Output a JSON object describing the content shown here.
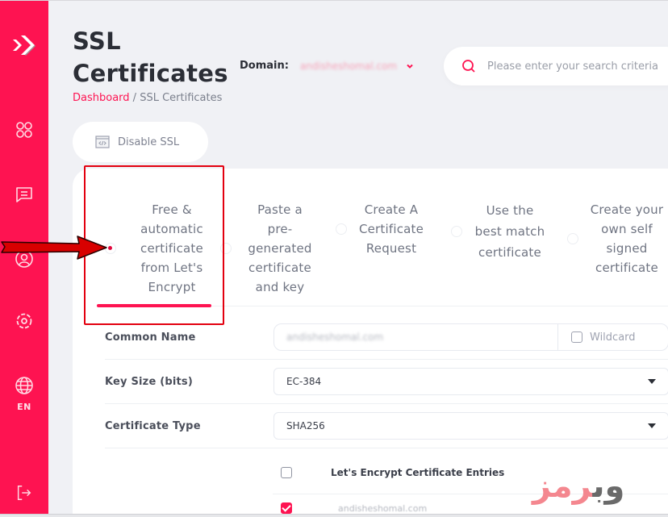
{
  "sidebar": {
    "items": [
      {
        "name": "logo",
        "icon": "double-chevron-logo-icon"
      },
      {
        "name": "dashboard",
        "icon": "apps-grid-icon"
      },
      {
        "name": "messages",
        "icon": "chat-icon"
      },
      {
        "name": "account",
        "icon": "user-circle-icon"
      },
      {
        "name": "settings",
        "icon": "gear-icon"
      },
      {
        "name": "language",
        "icon": "globe-icon",
        "label": "EN"
      },
      {
        "name": "logout",
        "icon": "logout-icon"
      }
    ]
  },
  "header": {
    "title_line1": "SSL",
    "title_line2": "Certificates",
    "breadcrumb": {
      "link": "Dashboard",
      "separator": " / ",
      "current": "SSL Certificates"
    },
    "domain_label": "Domain:",
    "domain_value": "andisheshomal.com",
    "search_placeholder": "Please enter your search criteria"
  },
  "actions": {
    "disable_ssl": "Disable SSL"
  },
  "certificate_options": [
    {
      "label": "Free & automatic certificate from Let's Encrypt",
      "lines": [
        "Free &",
        "automatic",
        "certificate",
        "from Let's",
        "Encrypt"
      ],
      "selected": true
    },
    {
      "label": "Paste a pre-generated certificate and key",
      "lines": [
        "Paste a",
        "pre-",
        "generated",
        "certificate",
        "and key"
      ],
      "selected": false
    },
    {
      "label": "Create A Certificate Request",
      "lines": [
        "Create A",
        "Certificate",
        "Request"
      ],
      "selected": false
    },
    {
      "label": "Use the best match certificate",
      "lines": [
        "Use the",
        "best match",
        "certificate"
      ],
      "selected": false
    },
    {
      "label": "Create your own self signed certificate",
      "lines": [
        "Create your",
        "own self",
        "signed",
        "certificate"
      ],
      "selected": false
    }
  ],
  "form": {
    "common_name": {
      "label": "Common Name",
      "value": "andisheshomal.com",
      "wildcard_label": "Wildcard",
      "wildcard_checked": false
    },
    "key_size": {
      "label": "Key Size (bits)",
      "value": "EC-384"
    },
    "certificate_type": {
      "label": "Certificate Type",
      "value": "SHA256"
    }
  },
  "entries": {
    "header": "Let's Encrypt Certificate Entries",
    "header_checked": false,
    "rows": [
      {
        "value": "andisheshomal.com",
        "checked": true
      }
    ]
  },
  "watermark": {
    "part1": "وب",
    "part2": "رمز"
  },
  "colors": {
    "brand": "#fe1351",
    "annotation": "#e3000f"
  }
}
